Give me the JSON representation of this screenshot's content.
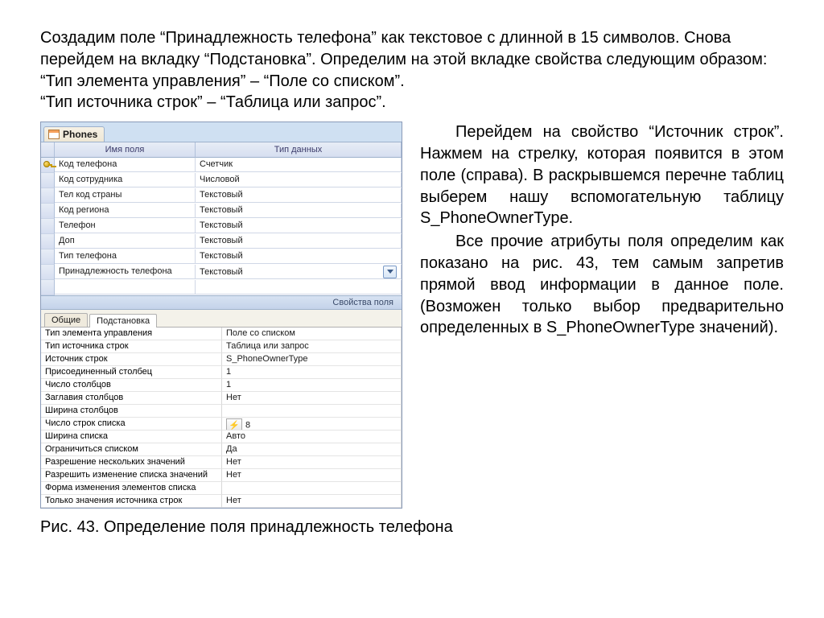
{
  "intro": {
    "p1": "Создадим поле “Принадлежность телефона” как текстовое с длинной в 15 символов.  Снова перейдем на вкладку “Подстановка”. Определим на этой вкладке свойства следующим образом:",
    "p2": "“Тип элемента управления” – “Поле со списком”.",
    "p3": "“Тип источника строк” – “Таблица или запрос”."
  },
  "access": {
    "table_name": "Phones",
    "columns": {
      "name": "Имя поля",
      "type": "Тип данных"
    },
    "fields": [
      {
        "key": true,
        "name": "Код телефона",
        "type": "Счетчик"
      },
      {
        "key": false,
        "name": "Код сотрудника",
        "type": "Числовой"
      },
      {
        "key": false,
        "name": "Тел код страны",
        "type": "Текстовый"
      },
      {
        "key": false,
        "name": "Код региона",
        "type": "Текстовый"
      },
      {
        "key": false,
        "name": "Телефон",
        "type": "Текстовый"
      },
      {
        "key": false,
        "name": "Доп",
        "type": "Текстовый"
      },
      {
        "key": false,
        "name": "Тип телефона",
        "type": "Текстовый"
      },
      {
        "key": false,
        "name": "Принадлежность телефона",
        "type": "Текстовый",
        "selected": true
      }
    ],
    "properties_heading": "Свойства поля",
    "prop_tabs": {
      "general": "Общие",
      "lookup": "Подстановка"
    },
    "lookup_props": [
      {
        "name": "Тип элемента управления",
        "value": "Поле со списком"
      },
      {
        "name": "Тип источника строк",
        "value": "Таблица или запрос"
      },
      {
        "name": "Источник строк",
        "value": "S_PhoneOwnerType"
      },
      {
        "name": "Присоединенный столбец",
        "value": "1"
      },
      {
        "name": "Число столбцов",
        "value": "1"
      },
      {
        "name": "Заглавия столбцов",
        "value": "Нет"
      },
      {
        "name": "Ширина столбцов",
        "value": ""
      },
      {
        "name": "Число строк списка",
        "value": "8",
        "highlight": true
      },
      {
        "name": "Ширина списка",
        "value": "Авто"
      },
      {
        "name": "Ограничиться списком",
        "value": "Да"
      },
      {
        "name": "Разрешение нескольких значений",
        "value": "Нет"
      },
      {
        "name": "Разрешить изменение списка значений",
        "value": "Нет"
      },
      {
        "name": "Форма изменения элементов списка",
        "value": ""
      },
      {
        "name": "Только значения источника строк",
        "value": "Нет"
      }
    ]
  },
  "side": {
    "p1": "Перейдем на свойство “Источник строк”. Нажмем на стрелку, которая появится в этом поле (справа). В раскрывшемся перечне таблиц выберем нашу вспомогательную таблицу S_PhoneOwnerType.",
    "p2": "Все прочие атрибуты поля определим как показано на рис. 43, тем самым запретив прямой ввод информации в данное поле. (Возможен только выбор предварительно определенных в S_PhoneOwnerType значений)."
  },
  "caption": "Рис. 43. Определение поля принадлежность телефона"
}
